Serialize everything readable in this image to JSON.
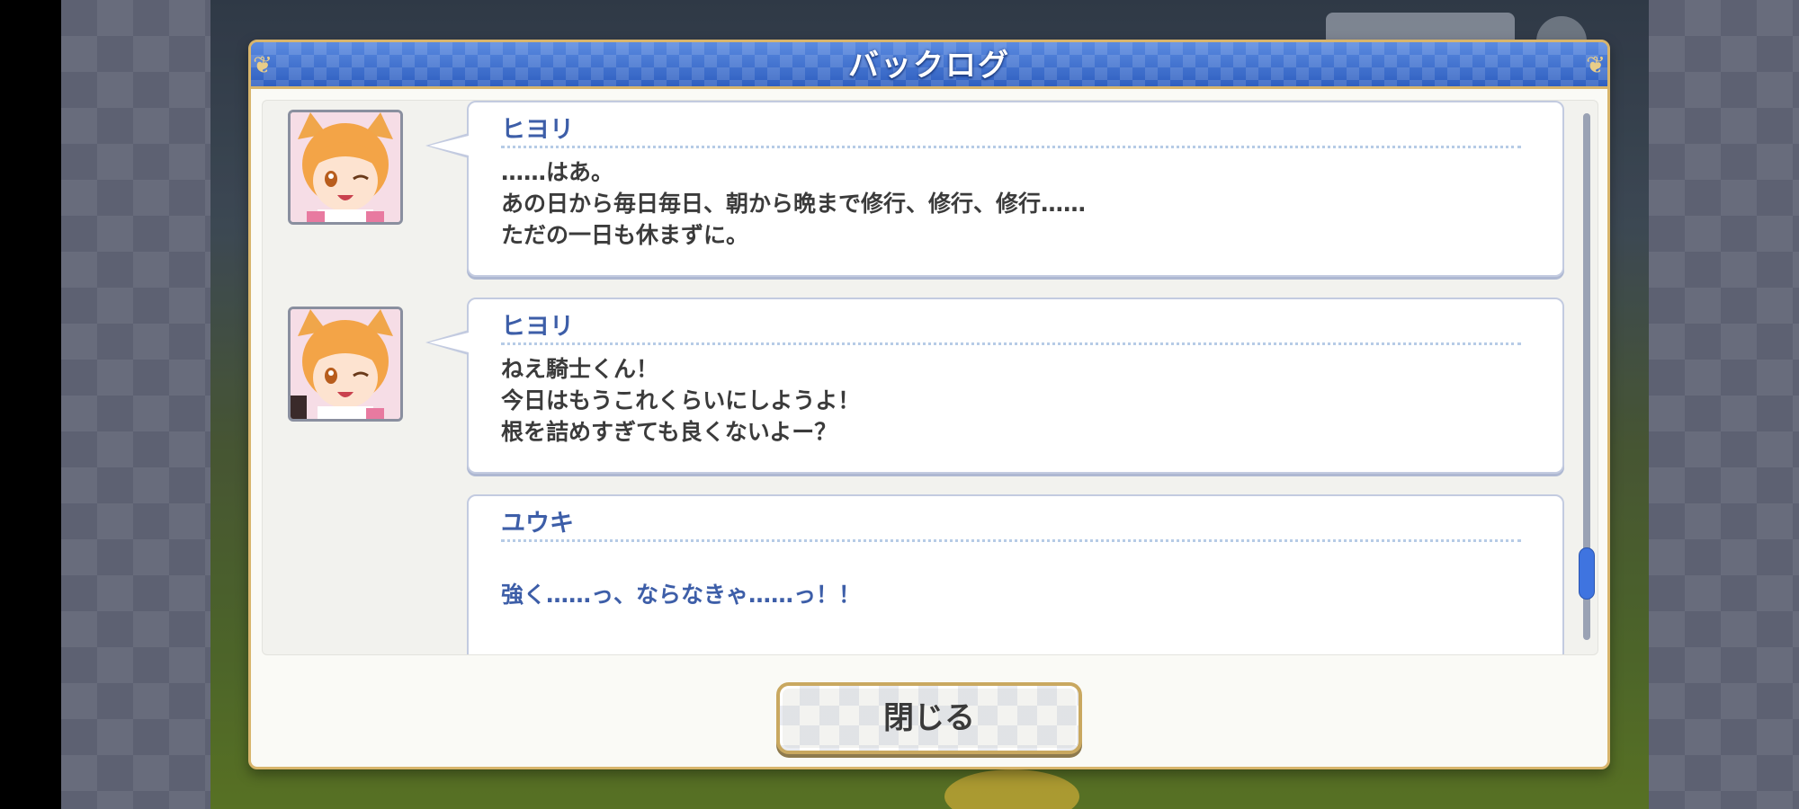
{
  "dialog": {
    "title": "バックログ",
    "close_label": "閉じる"
  },
  "backlog": {
    "entries": [
      {
        "speaker": "ヒヨリ",
        "avatar": "hiyori-portrait",
        "text": "……はあ。\nあの日から毎日毎日、朝から晩まで修行、修行、修行……\nただの一日も休まずに。"
      },
      {
        "speaker": "ヒヨリ",
        "avatar": "hiyori-portrait",
        "text": "ねえ騎士くん！\n今日はもうこれくらいにしようよ！\n根を詰めすぎても良くないよー？"
      },
      {
        "speaker": "ユウキ",
        "avatar": null,
        "text": "強く……っ、ならなきゃ……っ！！"
      }
    ]
  },
  "colors": {
    "header_blue": "#3d6fd0",
    "gold_border": "#d8b56c",
    "speaker_blue": "#3d5ea8",
    "scroll_thumb": "#3f74e0"
  }
}
